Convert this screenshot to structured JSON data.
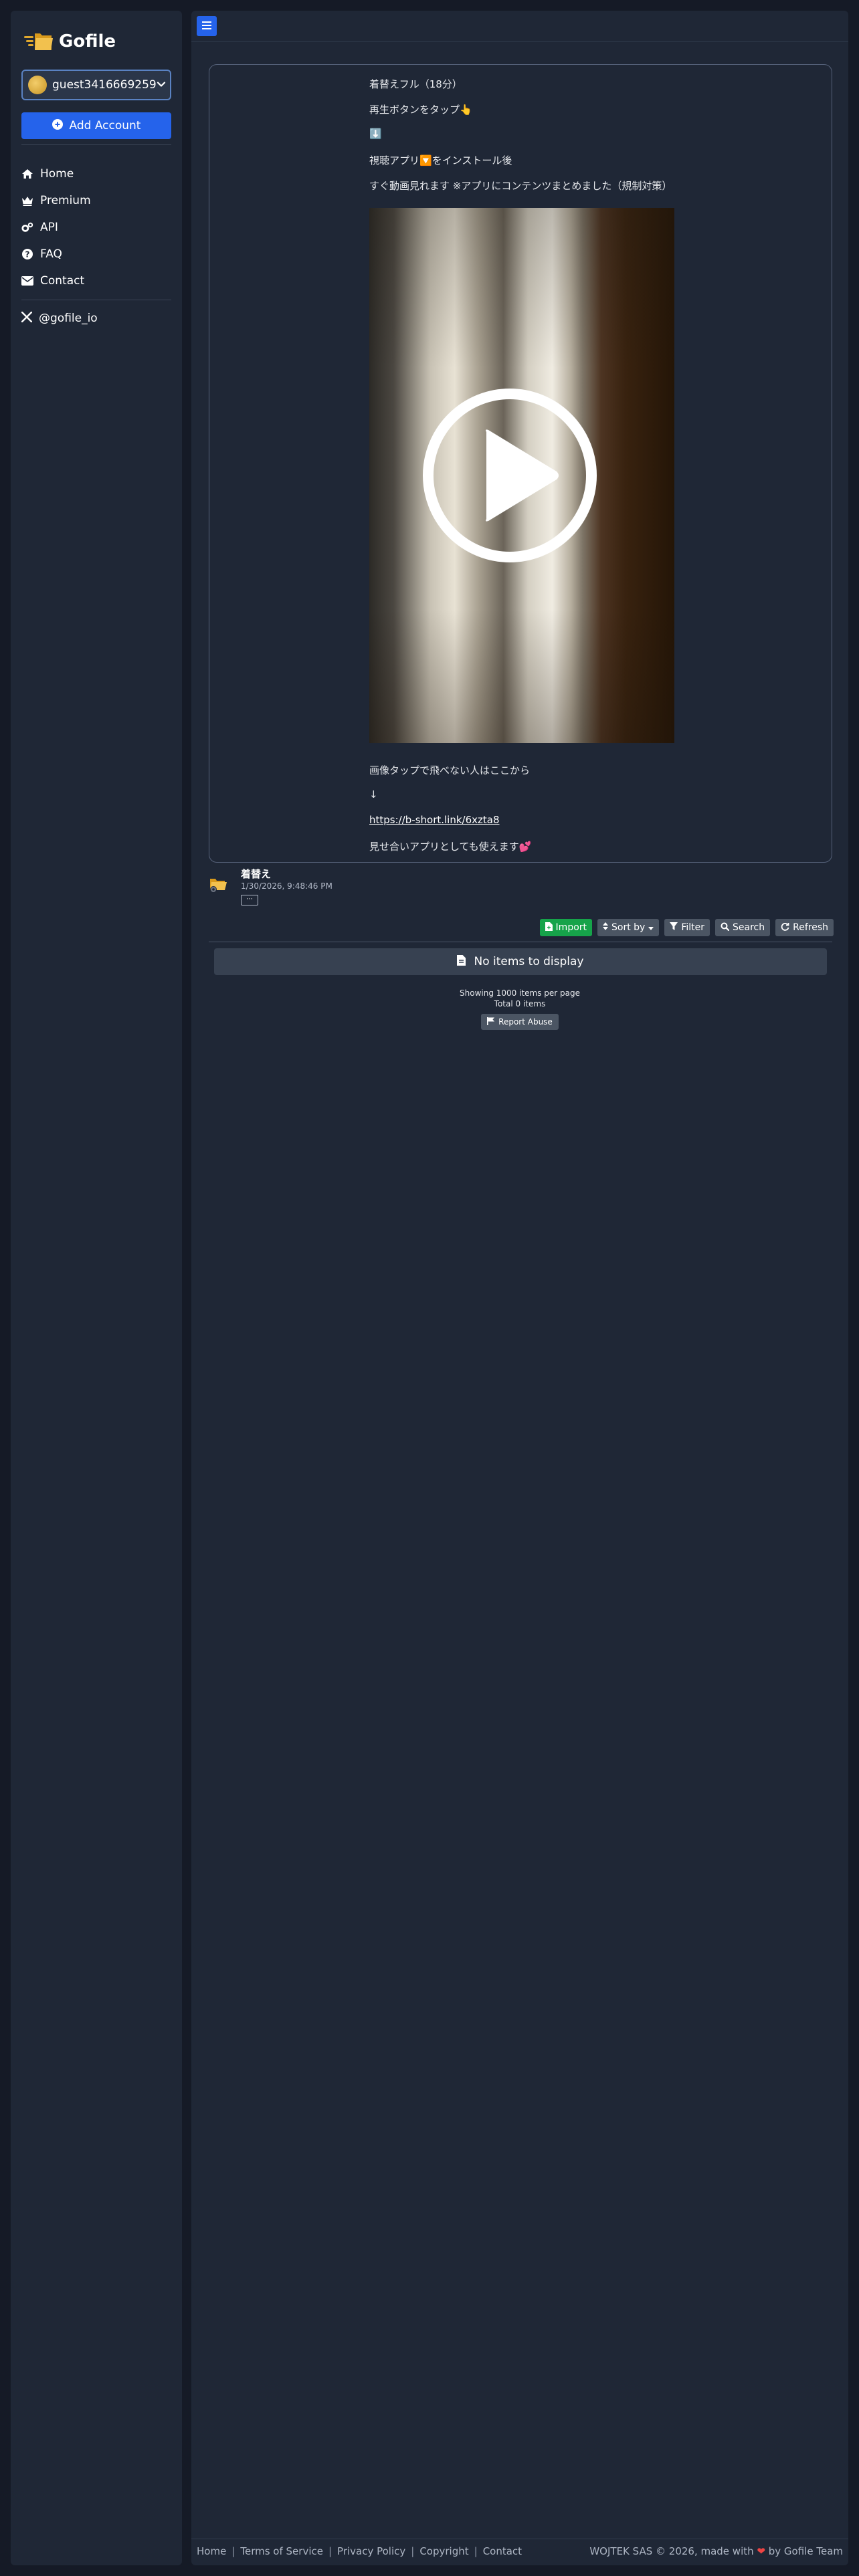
{
  "app": {
    "name": "Gofile"
  },
  "sidebar": {
    "account_name": "guest3416669259",
    "add_account_label": "Add Account",
    "nav": [
      {
        "label": "Home",
        "icon": "home-icon"
      },
      {
        "label": "Premium",
        "icon": "crown-icon"
      },
      {
        "label": "API",
        "icon": "gears-icon"
      },
      {
        "label": "FAQ",
        "icon": "question-circle-icon"
      },
      {
        "label": "Contact",
        "icon": "envelope-icon"
      }
    ],
    "social_label": "@gofile_io"
  },
  "content": {
    "description_lines": [
      "着替えフル（18分）",
      "再生ボタンをタップ👆",
      "⬇️",
      "視聴アプリ🔽をインストール後",
      "すぐ動画見れます ※アプリにコンテンツまとめました（規制対策）"
    ],
    "after_video_lines": [
      "画像タップで飛べない人はここから",
      "↓"
    ],
    "link_text": "https://b-short.link/6xzta8",
    "closing_line": "見せ合いアプリとしても使えます💕"
  },
  "folder": {
    "title": "着替え",
    "date": "1/30/2026, 9:48:46 PM",
    "more_label": "⋯"
  },
  "toolbar": {
    "import_label": "Import",
    "sort_label": "Sort by",
    "filter_label": "Filter",
    "search_label": "Search",
    "refresh_label": "Refresh"
  },
  "files": {
    "empty_message": "No items to display",
    "per_page_text": "Showing 1000 items per page",
    "total_text": "Total 0 items",
    "report_label": "Report Abuse"
  },
  "footer": {
    "links": [
      "Home",
      "Terms of Service",
      "Privacy Policy",
      "Copyright",
      "Contact"
    ],
    "separator": "|",
    "copyright_prefix": "WOJTEK SAS © 2026, made with",
    "heart": "❤",
    "copyright_suffix": "by Gofile Team"
  },
  "colors": {
    "accent": "#2563eb",
    "success": "#16a34a",
    "panel": "#1f2736",
    "background": "#151a26"
  }
}
